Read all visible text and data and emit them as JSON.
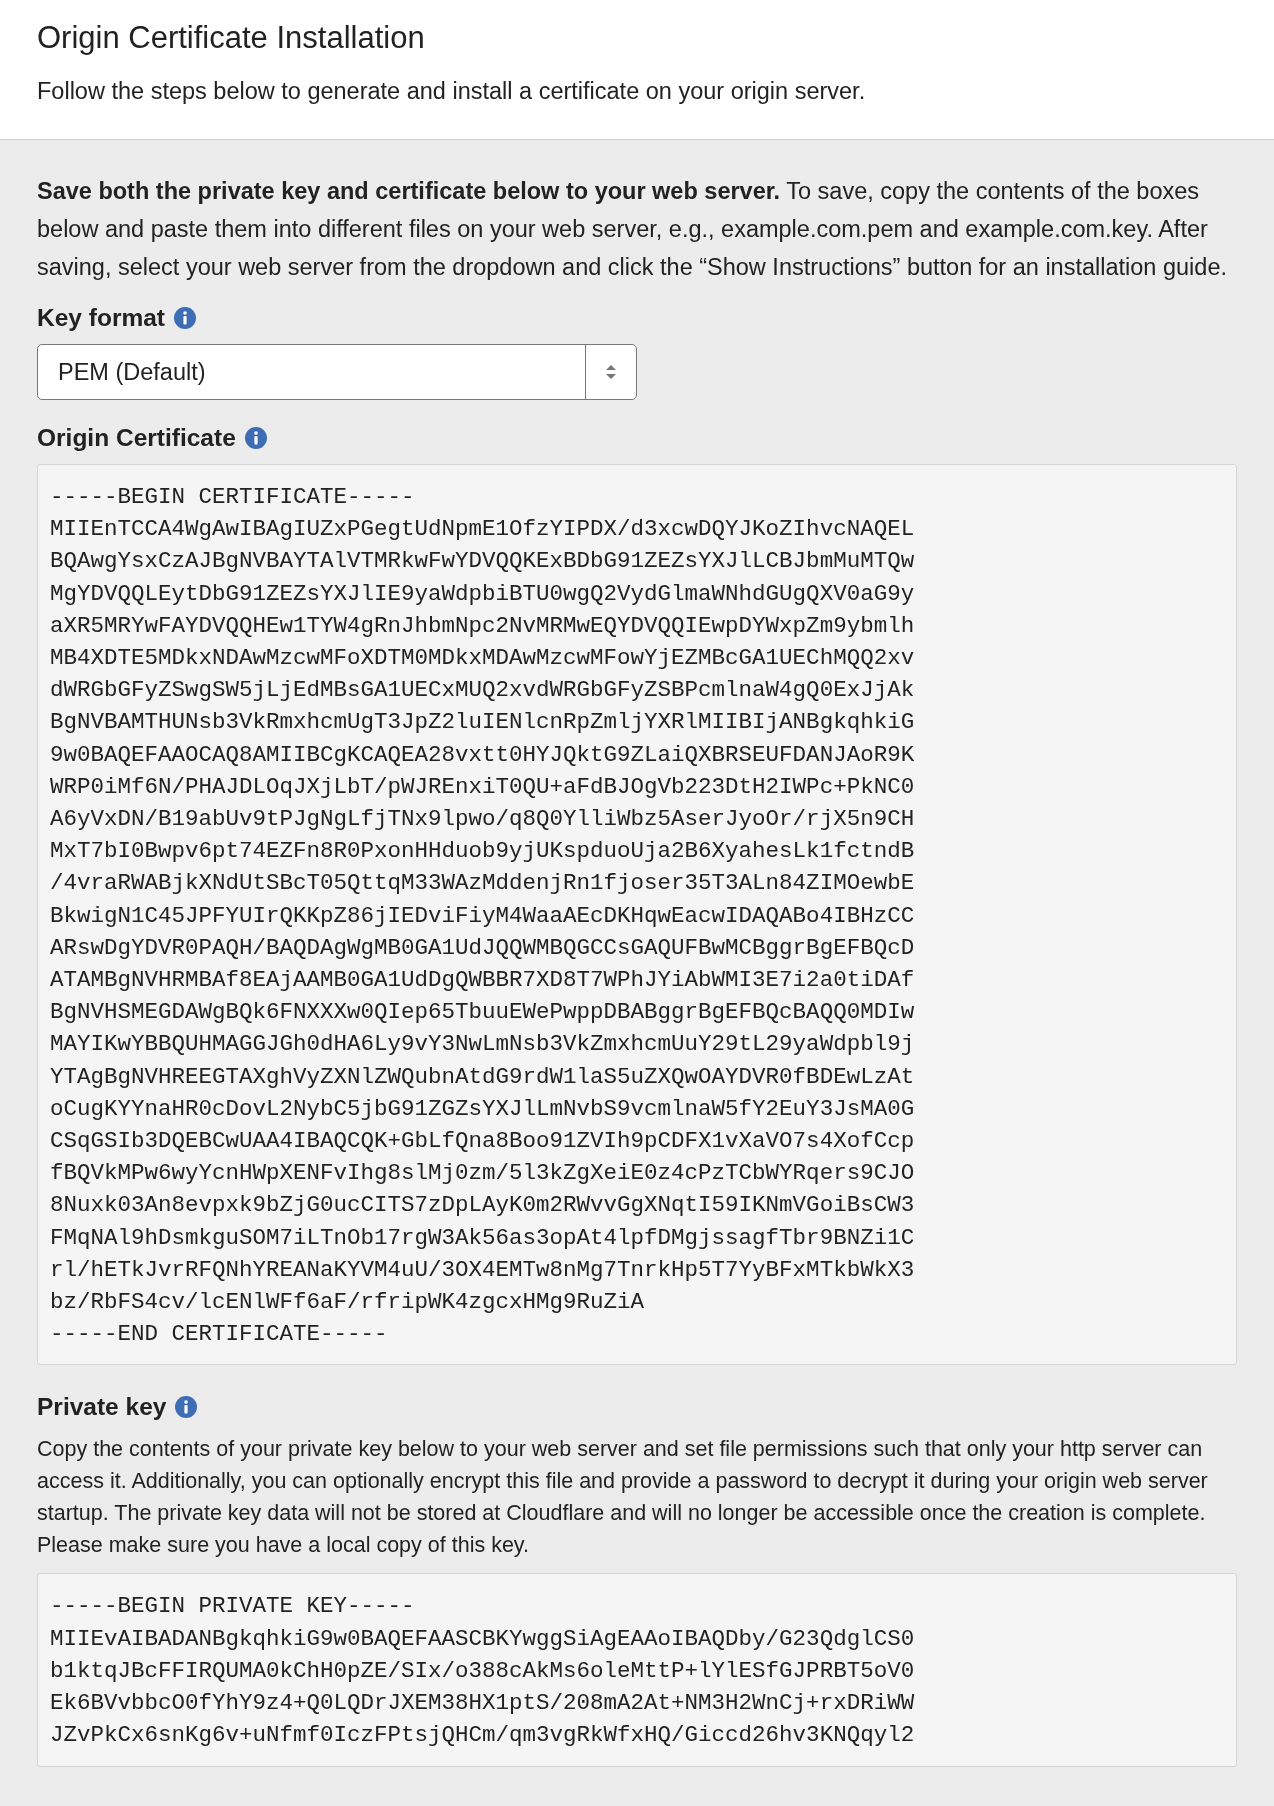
{
  "header": {
    "title": "Origin Certificate Installation",
    "subtitle": "Follow the steps below to generate and install a certificate on your origin server."
  },
  "intro": "**Save both the private key and certificate below to your web server.** To save, copy the contents of the boxes below and paste them into different files on your web server, e.g., example.com.pem and example.com.key. After saving, select your web server from the dropdown and click the “Show Instructions” button for an installation guide.",
  "key_format": {
    "label": "Key format",
    "info": true,
    "value": "PEM (Default)"
  },
  "origin_certificate": {
    "label": "Origin Certificate",
    "info": true,
    "lines": [
      "-----BEGIN CERTIFICATE-----",
      "MIIEnTCCA4WgAwIBAgIUZxPGegtUdNpmE1OfzYIPDX/d3xcwDQYJKoZIhvcNAQEL",
      "BQAwgYsxCzAJBgNVBAYTAlVTMRkwFwYDVQQKExBDbG91ZEZsYXJlLCBJbmMuMTQw",
      "MgYDVQQLEytDbG91ZEZsYXJlIE9yaWdpbiBTU0wgQ2VydGlmaWNhdGUgQXV0aG9y",
      "aXR5MRYwFAYDVQQHEw1TYW4gRnJhbmNpc2NvMRMwEQYDVQQIEwpDYWxpZm9ybmlh",
      "MB4XDTE5MDkxNDAwMzcwMFoXDTM0MDkxMDAwMzcwMFowYjEZMBcGA1UEChMQQ2xv",
      "dWRGbGFyZSwgSW5jLjEdMBsGA1UECxMUQ2xvdWRGbGFyZSBPcmlnaW4gQ0ExJjAk",
      "BgNVBAMTHUNsb3VkRmxhcmUgT3JpZ2luIENlcnRpZmljYXRlMIIBIjANBgkqhkiG",
      "9w0BAQEFAAOCAQ8AMIIBCgKCAQEA28vxtt0HYJQktG9ZLaiQXBRSEUFDANJAoR9K",
      "WRP0iMf6N/PHAJDLOqJXjLbT/pWJREnxiT0QU+aFdBJOgVb223DtH2IWPc+PkNC0",
      "A6yVxDN/B19abUv9tPJgNgLfjTNx9lpwo/q8Q0YlliWbz5AserJyoOr/rjX5n9CH",
      "MxT7bI0Bwpv6pt74EZFn8R0PxonHHduob9yjUKspduoUja2B6XyahesLk1fctndB",
      "/4vraRWABjkXNdUtSBcT05QttqM33WAzMddenjRn1fjoser35T3ALn84ZIMOewbE",
      "BkwigN1C45JPFYUIrQKKpZ86jIEDviFiyM4WaaAEcDKHqwEacwIDAQABo4IBHzCC",
      "ARswDgYDVR0PAQH/BAQDAgWgMB0GA1UdJQQWMBQGCCsGAQUFBwMCBggrBgEFBQcD",
      "ATAMBgNVHRMBAf8EAjAAMB0GA1UdDgQWBBR7XD8T7WPhJYiAbWMI3E7i2a0tiDAf",
      "BgNVHSMEGDAWgBQk6FNXXXw0QIep65TbuuEWePwppDBABggrBgEFBQcBAQQ0MDIw",
      "MAYIKwYBBQUHMAGGJGh0dHA6Ly9vY3NwLmNsb3VkZmxhcmUuY29tL29yaWdpbl9j",
      "YTAgBgNVHREEGTAXghVyZXNlZWQubnAtdG9rdW1laS5uZXQwOAYDVR0fBDEwLzAt",
      "oCugKYYnaHR0cDovL2NybC5jbG91ZGZsYXJlLmNvbS9vcmlnaW5fY2EuY3JsMA0G",
      "CSqGSIb3DQEBCwUAA4IBAQCQK+GbLfQna8Boo91ZVIh9pCDFX1vXaVO7s4XofCcp",
      "fBQVkMPw6wyYcnHWpXENFvIhg8slMj0zm/5l3kZgXeiE0z4cPzTCbWYRqers9CJO",
      "8Nuxk03An8evpxk9bZjG0ucCITS7zDpLAyK0m2RWvvGgXNqtI59IKNmVGoiBsCW3",
      "FMqNAl9hDsmkguSOM7iLTnOb17rgW3Ak56as3opAt4lpfDMgjssagfTbr9BNZi1C",
      "rl/hETkJvrRFQNhYREANaKYVM4uU/3OX4EMTw8nMg7TnrkHp5T7YyBFxMTkbWkX3",
      "bz/RbFS4cv/lcENlWFf6aF/rfripWK4zgcxHMg9RuZiA",
      "-----END CERTIFICATE-----"
    ]
  },
  "private_key": {
    "label": "Private key",
    "info": true,
    "description": "Copy the contents of your private key below to your web server and set file permissions such that only your http server can access it. Additionally, you can optionally encrypt this file and provide a password to decrypt it during your origin web server startup. The private key data will not be stored at Cloudflare and will no longer be accessible once the creation is complete. Please make sure you have a local copy of this key.",
    "lines": [
      "-----BEGIN PRIVATE KEY-----",
      "MIIEvAIBADANBgkqhkiG9w0BAQEFAASCBKYwggSiAgEAAoIBAQDby/G23QdglCS0",
      "b1ktqJBcFFIRQUMA0kChH0pZE/SIx/o388cAkMs6oleMttP+lYlESfGJPRBT5oV0",
      "Ek6BVvbbcO0fYhY9z4+Q0LQDrJXEM38HX1ptS/208mA2At+NM3H2WnCj+rxDRiWW",
      "JZvPkCx6snKg6v+uNfmf0IczFPtsjQHCm/qm3vgRkWfxHQ/Giccd26hv3KNQqyl2"
    ]
  }
}
